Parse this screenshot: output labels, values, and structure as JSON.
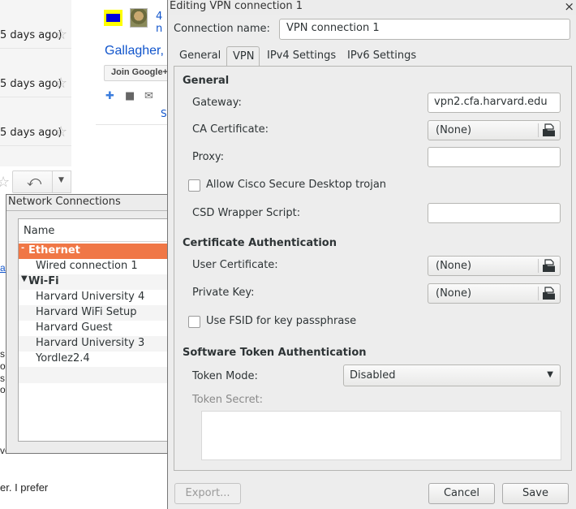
{
  "background_page": {
    "mail_rows": [
      {
        "ago": "5 days ago)"
      },
      {
        "ago": "5 days ago)"
      },
      {
        "ago": "5 days ago)"
      }
    ],
    "count_link": "4 n",
    "person_name": "Gallagher,",
    "join_button": "Join Google+",
    "s_link": "S",
    "fragments": [
      "ar",
      "s",
      "o",
      "s",
      "o",
      "ve"
    ],
    "snippet": "er. I prefer"
  },
  "network_connections": {
    "title": "Network Connections",
    "column_header": "Name",
    "groups": [
      {
        "label": "Ethernet",
        "items": [
          "Wired connection 1"
        ]
      },
      {
        "label": "Wi-Fi",
        "items": [
          "Harvard University 4",
          "Harvard WiFi Setup",
          "Harvard Guest",
          "Harvard University 3",
          "Yordlez2.4"
        ]
      }
    ]
  },
  "vpn_dialog": {
    "title": "Editing VPN connection 1",
    "connection_name_label": "Connection name:",
    "connection_name_value": "VPN connection 1",
    "tabs": [
      "General",
      "VPN",
      "IPv4 Settings",
      "IPv6 Settings"
    ],
    "active_tab": "VPN",
    "general_section": {
      "heading": "General",
      "gateway_label": "Gateway:",
      "gateway_value": "vpn2.cfa.harvard.edu",
      "ca_cert_label": "CA Certificate:",
      "ca_cert_value": "(None)",
      "proxy_label": "Proxy:",
      "proxy_value": "",
      "cisco_checkbox_label": "Allow Cisco Secure Desktop trojan",
      "cisco_checked": false,
      "csd_label": "CSD Wrapper Script:",
      "csd_value": ""
    },
    "cert_section": {
      "heading": "Certificate Authentication",
      "user_cert_label": "User Certificate:",
      "user_cert_value": "(None)",
      "private_key_label": "Private Key:",
      "private_key_value": "(None)",
      "fsid_checkbox_label": "Use FSID for key passphrase",
      "fsid_checked": false
    },
    "token_section": {
      "heading": "Software Token Authentication",
      "token_mode_label": "Token Mode:",
      "token_mode_value": "Disabled",
      "token_secret_label": "Token Secret:"
    },
    "buttons": {
      "export": "Export...",
      "cancel": "Cancel",
      "save": "Save"
    }
  }
}
